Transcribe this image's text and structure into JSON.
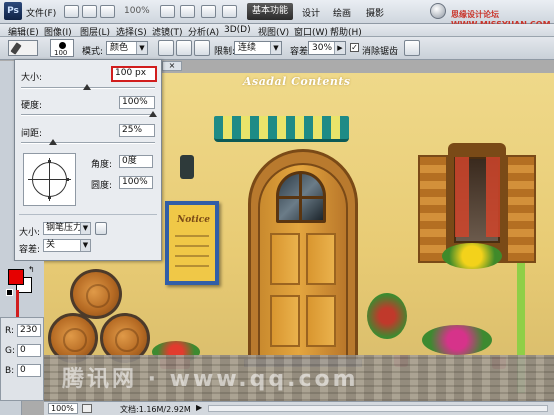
{
  "menubar": {
    "logo": "Ps",
    "items": [
      "文件(F)",
      "编辑(E)",
      "图像(I)",
      "图层(L)",
      "选择(S)",
      "滤镜(T)",
      "分析(A)",
      "3D(D)",
      "视图(V)",
      "窗口(W)",
      "帮助(H)"
    ],
    "zoom": "100%",
    "workspace_active": "基本功能",
    "workspace_items": [
      "设计",
      "绘画",
      "摄影"
    ],
    "watermark": "思缘设计论坛 WWW.MISSYUAN.COM"
  },
  "options": {
    "brush_size_preview": "100",
    "mode_label": "模式:",
    "mode_value": "颜色",
    "limit_label": "限制:",
    "limit_value": "连续",
    "tolerance_label": "容差:",
    "tolerance_value": "30%",
    "antialias_label": "消除锯齿",
    "antialias_checked": "✓"
  },
  "brush_panel": {
    "size_label": "大小:",
    "size_value": "100 px",
    "hardness_label": "硬度:",
    "hardness_value": "100%",
    "spacing_label": "间距:",
    "spacing_value": "25%",
    "angle_label": "角度:",
    "angle_value": "0度",
    "roundness_label": "圆度:",
    "roundness_value": "100%",
    "size_control_label": "大小:",
    "size_control_value": "钢笔压力",
    "tolerance_label": "容差:",
    "tolerance_value": "关"
  },
  "canvas": {
    "doc_tab": "×",
    "title": "Asadal Contents",
    "sign_text": "Notice",
    "watermark": "腾讯网 · www.qq.com"
  },
  "colors": {
    "foreground": "#e60000",
    "background": "#ffffff",
    "accent_red": "#d11d1d"
  },
  "rgb": {
    "r_label": "R:",
    "r_value": "230",
    "g_label": "G:",
    "g_value": "0",
    "b_label": "B:",
    "b_value": "0"
  },
  "status": {
    "zoom": "100%",
    "doc_info": "文档:1.16M/2.92M",
    "arrow": "▶"
  }
}
